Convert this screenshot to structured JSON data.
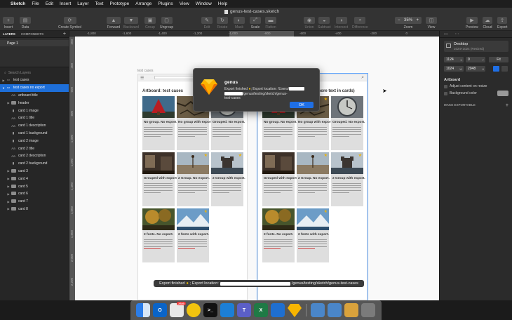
{
  "menubar": {
    "app": "Sketch",
    "items": [
      "File",
      "Edit",
      "Insert",
      "Layer",
      "Text",
      "Prototype",
      "Arrange",
      "Plugins",
      "View",
      "Window",
      "Help"
    ]
  },
  "window": {
    "title": "genus-test-cases.sketch"
  },
  "toolbar": {
    "insert": "Insert",
    "data": "Data",
    "create_symbol": "Create Symbol",
    "forward": "Forward",
    "backward": "Backward",
    "group": "Group",
    "ungroup": "Ungroup",
    "edit": "Edit",
    "rotate": "Rotate",
    "mask": "Mask",
    "scale": "Scale",
    "flatten": "Flatten",
    "union": "Union",
    "subtract": "Subtract",
    "intersect": "Intersect",
    "difference": "Difference",
    "zoom_value": "35%",
    "zoom": "Zoom",
    "view": "View",
    "preview": "Preview",
    "cloud": "Cloud",
    "export": "Export"
  },
  "left_panel": {
    "tab_layers": "LAYERS",
    "tab_components": "COMPONENTS",
    "page": "Page 1",
    "search_placeholder": "Search Layers",
    "layers": [
      {
        "label": "test cases",
        "icon": "artboard",
        "depth": 0,
        "expanded": false,
        "selected": false
      },
      {
        "label": "test cases no export",
        "icon": "artboard",
        "depth": 0,
        "expanded": true,
        "selected": true
      },
      {
        "label": "artboard title",
        "icon": "text",
        "depth": 1,
        "expanded": false,
        "selected": false
      },
      {
        "label": "header",
        "icon": "folder",
        "depth": 1,
        "expanded": false,
        "selected": false
      },
      {
        "label": "card 1 image",
        "icon": "rect",
        "depth": 1,
        "expanded": false,
        "selected": false
      },
      {
        "label": "card 1 title",
        "icon": "text",
        "depth": 1,
        "expanded": false,
        "selected": false
      },
      {
        "label": "card 1 description",
        "icon": "text",
        "depth": 1,
        "expanded": false,
        "selected": false
      },
      {
        "label": "card 1 background",
        "icon": "rect",
        "depth": 1,
        "expanded": false,
        "selected": false
      },
      {
        "label": "card 2 image",
        "icon": "rect",
        "depth": 1,
        "expanded": false,
        "selected": false
      },
      {
        "label": "card 2 title",
        "icon": "text",
        "depth": 1,
        "expanded": false,
        "selected": false
      },
      {
        "label": "card 2 description",
        "icon": "text",
        "depth": 1,
        "expanded": false,
        "selected": false
      },
      {
        "label": "card 2 background",
        "icon": "rect",
        "depth": 1,
        "expanded": false,
        "selected": false
      },
      {
        "label": "card 3",
        "icon": "folder",
        "depth": 1,
        "expanded": false,
        "selected": false
      },
      {
        "label": "card 4",
        "icon": "folder",
        "depth": 1,
        "expanded": false,
        "selected": false
      },
      {
        "label": "card 5",
        "icon": "folder",
        "depth": 1,
        "expanded": false,
        "selected": false
      },
      {
        "label": "card 6",
        "icon": "folder",
        "depth": 1,
        "expanded": false,
        "selected": false
      },
      {
        "label": "card 7",
        "icon": "folder",
        "depth": 1,
        "expanded": false,
        "selected": false
      },
      {
        "label": "card 8",
        "icon": "folder",
        "depth": 1,
        "expanded": false,
        "selected": false
      }
    ]
  },
  "ruler": {
    "h_ticks": [
      "-1,800",
      "-1,600",
      "-1,400",
      "-1,200",
      "-1,000",
      "-800",
      "-600",
      "-400",
      "-200",
      "0",
      "200"
    ],
    "v_ticks": [
      "200",
      "400",
      "600",
      "800",
      "1,000",
      "1,200",
      "1,400",
      "1,600",
      "1,800",
      "2,000",
      "2,200"
    ]
  },
  "canvas": {
    "artboard_label": "test cases",
    "left_title": "Artboard: test cases",
    "right_title_partial": "more text in cards)",
    "cards": [
      {
        "title": "No group. No export.",
        "image": "tree"
      },
      {
        "title": "No group with export.",
        "image": "crack"
      },
      {
        "title": "Grouped. No export.",
        "image": "clock"
      },
      {
        "title": "Grouped with export.",
        "image": "room"
      },
      {
        "title": "2 Group. No export.",
        "image": "beach"
      },
      {
        "title": "2 Group with export.",
        "image": "castle"
      },
      {
        "title": "2 fonts. No export.",
        "image": "autumn"
      },
      {
        "title": "2 fonts with export.",
        "image": "mountain"
      }
    ]
  },
  "dialog": {
    "title": "genus",
    "message_start": "Export finished",
    "message_location": "Export location: /Users/",
    "message_path": "/genus/testing/sketch/genus-",
    "message_end": "test-cases",
    "ok_label": "OK"
  },
  "toast": {
    "start": "Export finished",
    "location": "; Export location:",
    "path_end": "/genus/testing/sketch/genus-test-cases"
  },
  "inspector": {
    "device_name": "Desktop",
    "device_size": "1024×1024 (Resized)",
    "x": "1124",
    "y": "0",
    "rot": "0",
    "w": "1024",
    "h": "2048",
    "fit": "Fit",
    "x_unit": "X",
    "y_unit": "Y",
    "w_unit": "W",
    "h_unit": "H",
    "section_artboard": "Artboard",
    "adjust_label": "Adjust content on resize",
    "background_label": "Background color",
    "make_exportable": "MAKE EXPORTABLE"
  },
  "dock": {
    "items": [
      {
        "name": "finder",
        "color": "#2b7de9"
      },
      {
        "name": "outlook",
        "color": "#0a64c8",
        "label": "O"
      },
      {
        "name": "calendar",
        "color": "#e8e8e8",
        "badge": "2680"
      },
      {
        "name": "chrome",
        "color": "#f1c40f"
      },
      {
        "name": "terminal",
        "color": "#111111",
        "label": ">_"
      },
      {
        "name": "vscode",
        "color": "#1c7fd6"
      },
      {
        "name": "teams",
        "color": "#5b5fc7",
        "label": "T"
      },
      {
        "name": "excel",
        "color": "#1f7a45",
        "label": "X"
      },
      {
        "name": "sourcetree",
        "color": "#1f6fd0"
      },
      {
        "name": "sketch",
        "color": "#f7b500"
      },
      {
        "name": "downloads",
        "color": "#4a86c9"
      },
      {
        "name": "documents",
        "color": "#4a86c9"
      },
      {
        "name": "archive",
        "color": "#d9a23c"
      },
      {
        "name": "trash",
        "color": "#7b7b7b"
      }
    ]
  }
}
